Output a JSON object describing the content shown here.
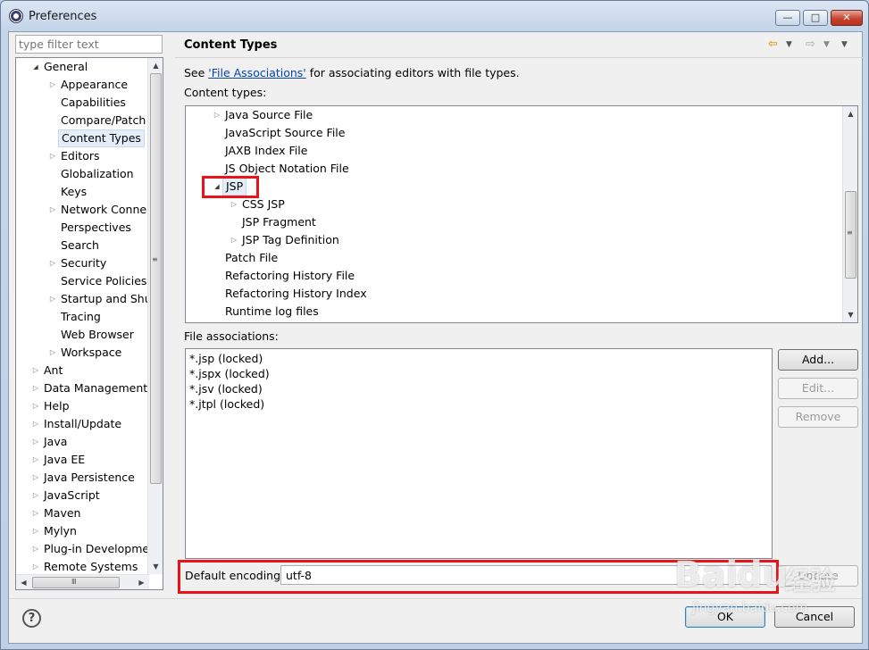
{
  "window": {
    "title": "Preferences",
    "min_glyph": "—",
    "max_glyph": "□",
    "close_glyph": "✕"
  },
  "filter": {
    "placeholder": "type filter text"
  },
  "tree": [
    {
      "label": "General",
      "level": 0,
      "twisty": "open"
    },
    {
      "label": "Appearance",
      "level": 1,
      "twisty": "closed"
    },
    {
      "label": "Capabilities",
      "level": 1,
      "twisty": "none"
    },
    {
      "label": "Compare/Patch",
      "level": 1,
      "twisty": "none"
    },
    {
      "label": "Content Types",
      "level": 1,
      "twisty": "none",
      "selected": true
    },
    {
      "label": "Editors",
      "level": 1,
      "twisty": "closed"
    },
    {
      "label": "Globalization",
      "level": 1,
      "twisty": "none"
    },
    {
      "label": "Keys",
      "level": 1,
      "twisty": "none"
    },
    {
      "label": "Network Connectio",
      "level": 1,
      "twisty": "closed"
    },
    {
      "label": "Perspectives",
      "level": 1,
      "twisty": "none"
    },
    {
      "label": "Search",
      "level": 1,
      "twisty": "none"
    },
    {
      "label": "Security",
      "level": 1,
      "twisty": "closed"
    },
    {
      "label": "Service Policies",
      "level": 1,
      "twisty": "none"
    },
    {
      "label": "Startup and Shutd",
      "level": 1,
      "twisty": "closed"
    },
    {
      "label": "Tracing",
      "level": 1,
      "twisty": "none"
    },
    {
      "label": "Web Browser",
      "level": 1,
      "twisty": "none"
    },
    {
      "label": "Workspace",
      "level": 1,
      "twisty": "closed"
    },
    {
      "label": "Ant",
      "level": 0,
      "twisty": "closed"
    },
    {
      "label": "Data Management",
      "level": 0,
      "twisty": "closed"
    },
    {
      "label": "Help",
      "level": 0,
      "twisty": "closed"
    },
    {
      "label": "Install/Update",
      "level": 0,
      "twisty": "closed"
    },
    {
      "label": "Java",
      "level": 0,
      "twisty": "closed"
    },
    {
      "label": "Java EE",
      "level": 0,
      "twisty": "closed"
    },
    {
      "label": "Java Persistence",
      "level": 0,
      "twisty": "closed"
    },
    {
      "label": "JavaScript",
      "level": 0,
      "twisty": "closed"
    },
    {
      "label": "Maven",
      "level": 0,
      "twisty": "closed"
    },
    {
      "label": "Mylyn",
      "level": 0,
      "twisty": "closed"
    },
    {
      "label": "Plug-in Development",
      "level": 0,
      "twisty": "closed"
    },
    {
      "label": "Remote Systems",
      "level": 0,
      "twisty": "closed"
    }
  ],
  "page": {
    "title": "Content Types",
    "see_prefix": "See ",
    "see_link": "'File Associations'",
    "see_suffix": " for associating editors with file types.",
    "content_types_label": "Content types:",
    "file_assoc_label": "File associations:",
    "encoding_label": "Default encoding:",
    "encoding_value": "utf-8"
  },
  "content_types": [
    {
      "label": "Java Source File",
      "level": 0,
      "twisty": "closed"
    },
    {
      "label": "JavaScript Source File",
      "level": 0,
      "twisty": "none"
    },
    {
      "label": "JAXB Index File",
      "level": 0,
      "twisty": "none"
    },
    {
      "label": "JS Object Notation File",
      "level": 0,
      "twisty": "none"
    },
    {
      "label": "JSP",
      "level": 0,
      "twisty": "open",
      "selected": true
    },
    {
      "label": "CSS JSP",
      "level": 1,
      "twisty": "closed"
    },
    {
      "label": "JSP Fragment",
      "level": 1,
      "twisty": "none"
    },
    {
      "label": "JSP Tag Definition",
      "level": 1,
      "twisty": "closed"
    },
    {
      "label": "Patch File",
      "level": 0,
      "twisty": "none"
    },
    {
      "label": "Refactoring History File",
      "level": 0,
      "twisty": "none"
    },
    {
      "label": "Refactoring History Index",
      "level": 0,
      "twisty": "none"
    },
    {
      "label": "Runtime log files",
      "level": 0,
      "twisty": "none"
    }
  ],
  "file_associations": [
    "*.jsp (locked)",
    "*.jspx (locked)",
    "*.jsv (locked)",
    "*.jtpl (locked)"
  ],
  "buttons": {
    "add": "Add...",
    "edit": "Edit...",
    "remove": "Remove",
    "update": "Update",
    "ok": "OK",
    "cancel": "Cancel",
    "help": "?"
  },
  "icons": {
    "back": "back-arrow-icon",
    "forward": "forward-arrow-icon",
    "twisty_open": "◢",
    "twisty_closed": "▷",
    "up": "▲",
    "down": "▼",
    "left": "◀",
    "right": "▶",
    "grip": "≡",
    "grip_h": "Ⅲ"
  },
  "watermark": {
    "text1": "Bai",
    "text2": "du",
    "text3": "经验",
    "sub": "jingyan.baidu.com"
  },
  "colors": {
    "highlight": "#e8141a",
    "link": "#0645ad",
    "selection": "#e4eef9"
  }
}
